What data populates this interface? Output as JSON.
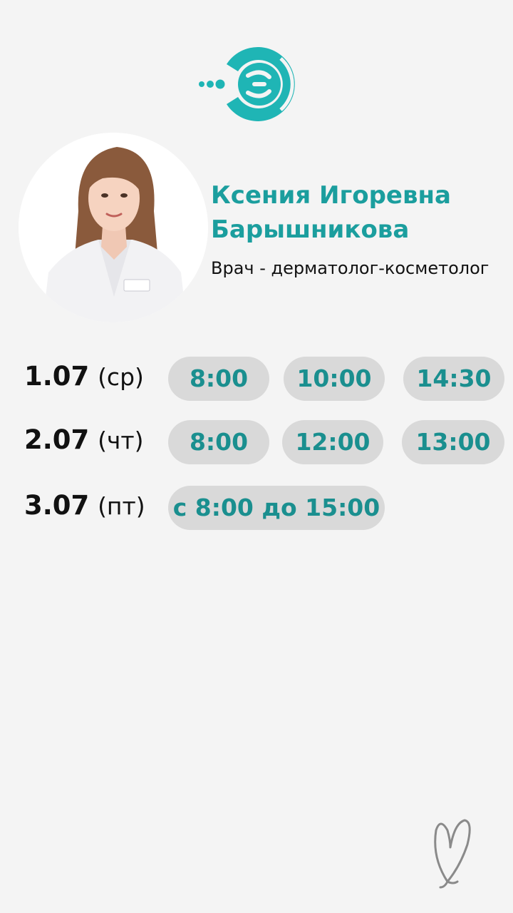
{
  "colors": {
    "accent": "#1b9e9e",
    "slot_bg": "#d9d9d9",
    "slot_text": "#1a8f8f",
    "background": "#f4f4f4"
  },
  "doctor": {
    "name_line1": "Ксения Игоревна",
    "name_line2": "Барышникова",
    "title": "Врач - дерматолог-косметолог",
    "photo_icon": "doctor-portrait"
  },
  "schedule": [
    {
      "date": "1.07",
      "day": "(ср)",
      "slots": [
        "8:00",
        "10:00",
        "14:30"
      ]
    },
    {
      "date": "2.07",
      "day": "(чт)",
      "slots": [
        "8:00",
        "12:00",
        "13:00"
      ]
    },
    {
      "date": "3.07",
      "day": "(пт)",
      "slots": [
        "с 8:00 до 15:00"
      ]
    }
  ]
}
